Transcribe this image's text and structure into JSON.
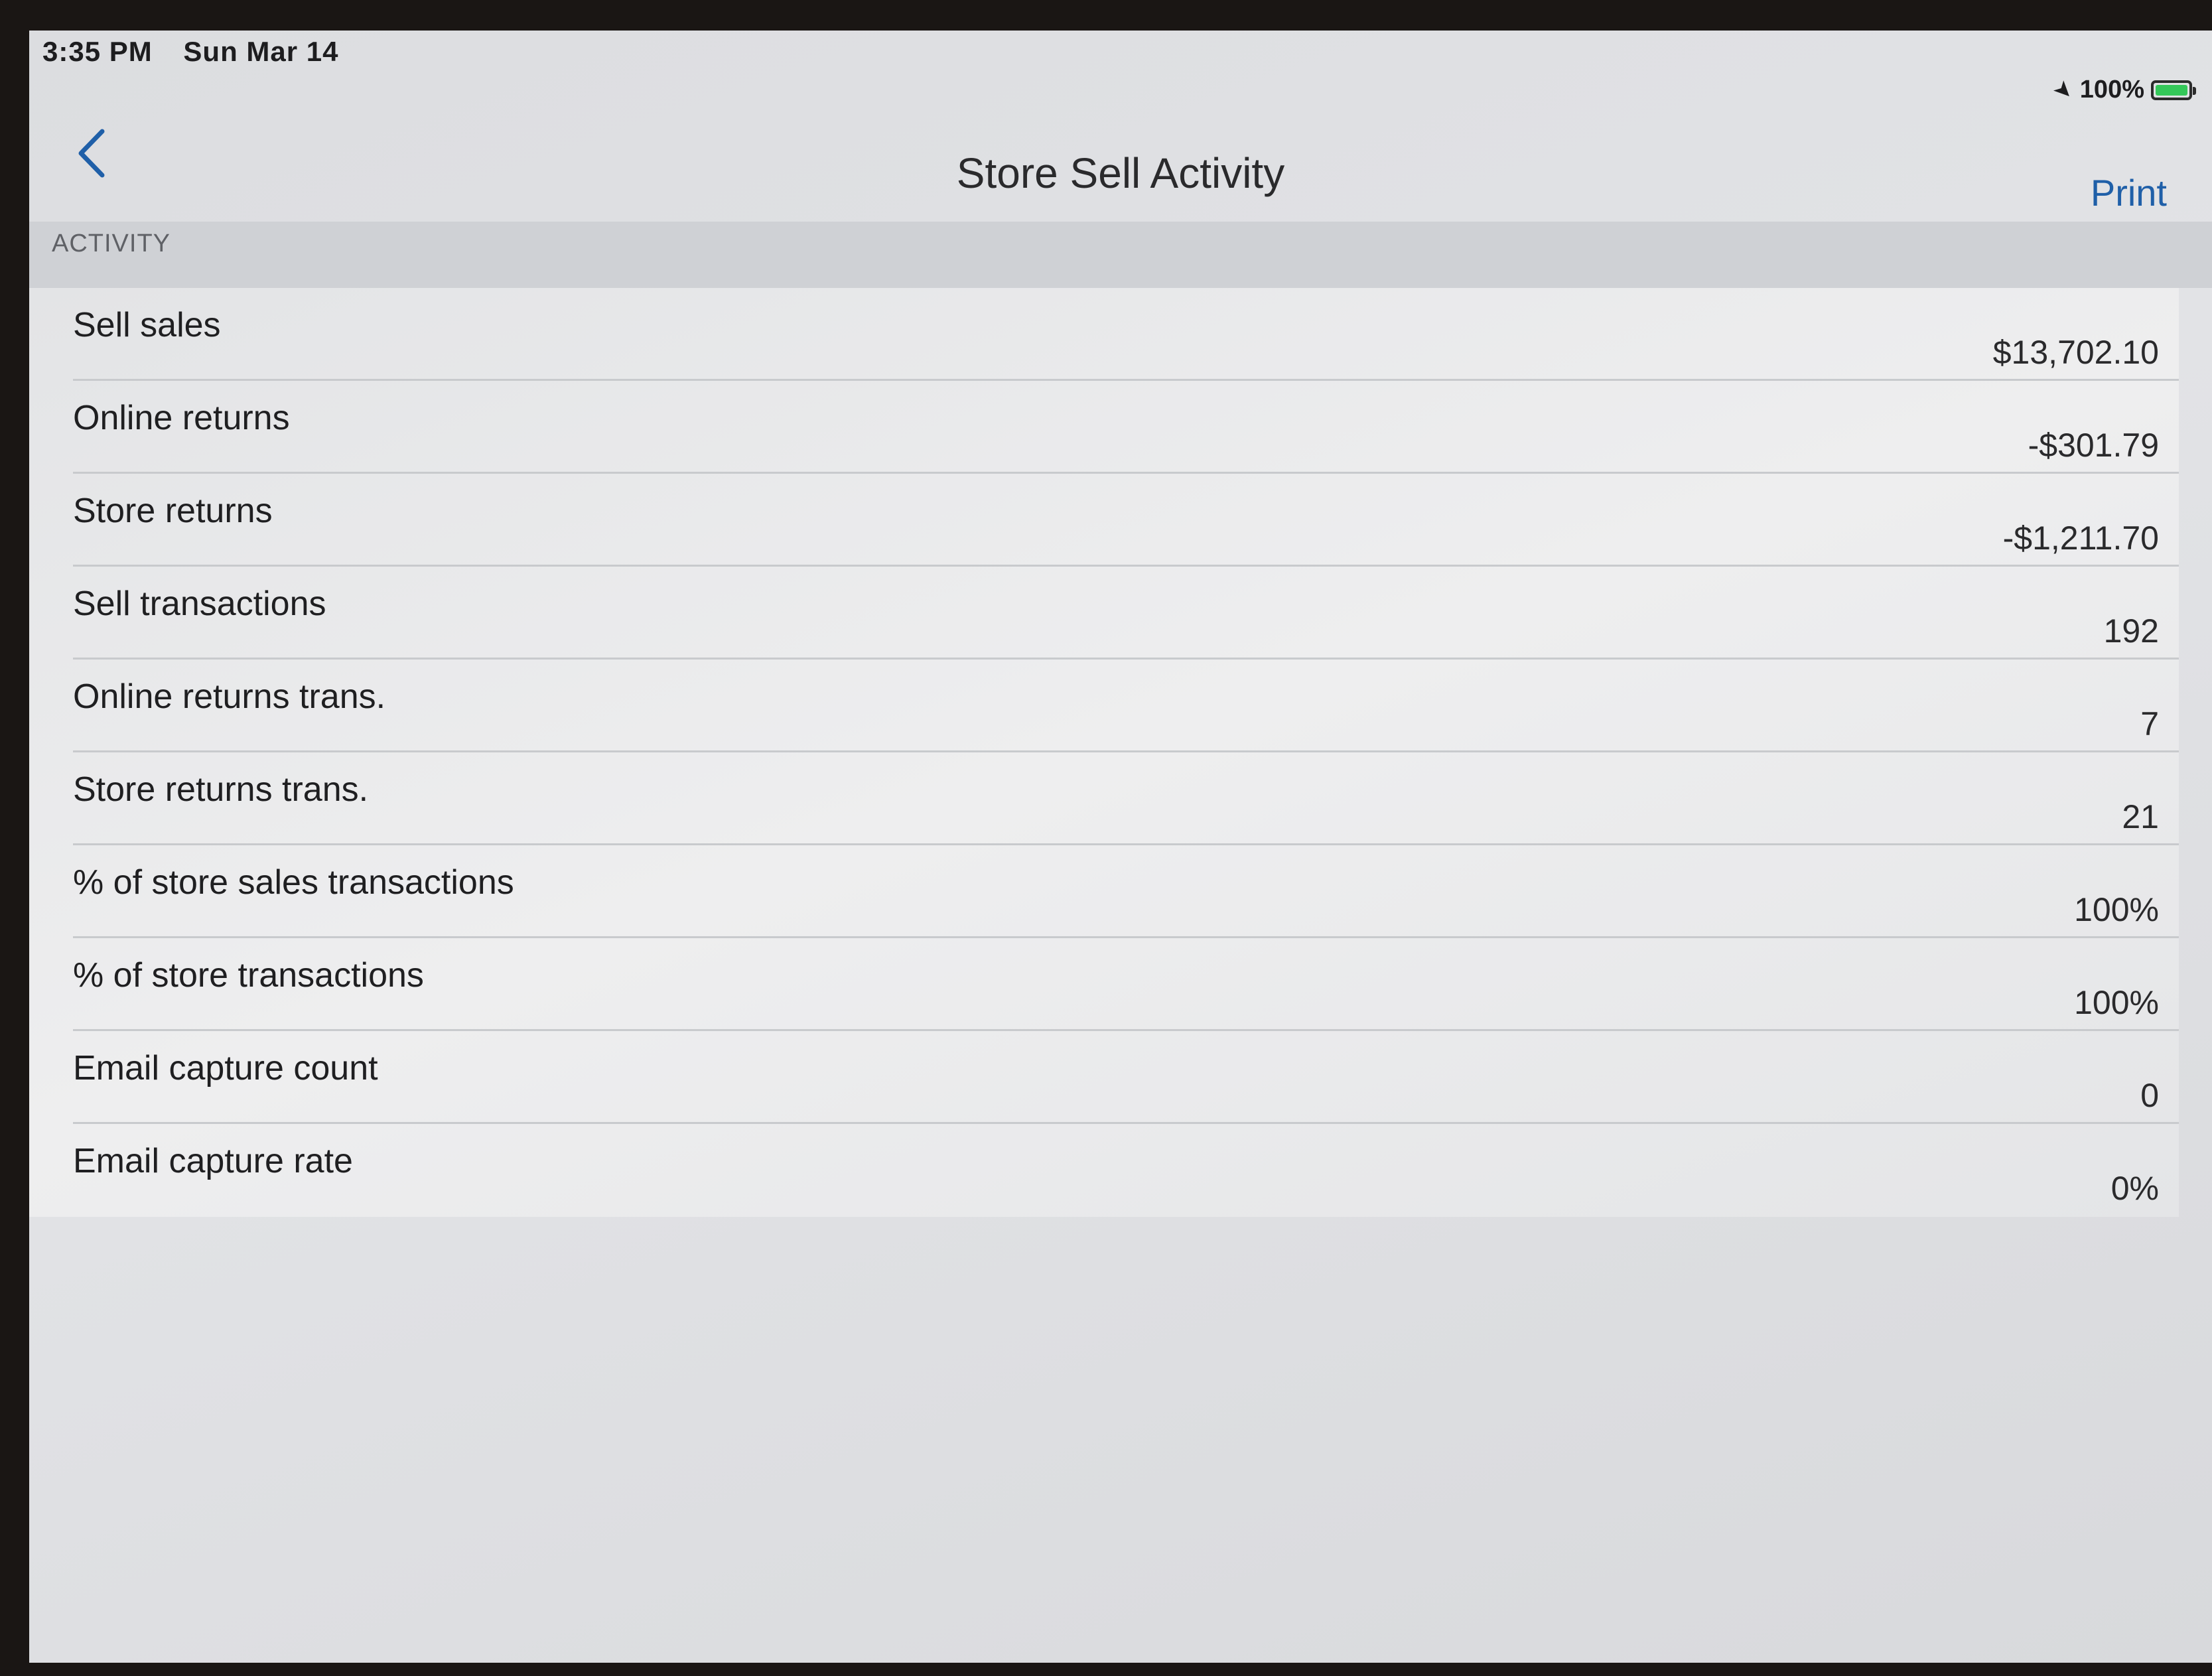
{
  "status_bar": {
    "time": "3:35 PM",
    "date": "Sun Mar 14",
    "battery": "100%",
    "location_icon": "location-arrow-icon",
    "battery_icon": "battery-charging-icon"
  },
  "nav": {
    "back_icon": "chevron-left-icon",
    "title": "Store Sell Activity",
    "print_label": "Print"
  },
  "section": {
    "header": "ACTIVITY"
  },
  "rows": [
    {
      "label": "Sell sales",
      "value": "$13,702.10"
    },
    {
      "label": "Online returns",
      "value": "-$301.79"
    },
    {
      "label": "Store returns",
      "value": "-$1,211.70"
    },
    {
      "label": "Sell transactions",
      "value": "192"
    },
    {
      "label": "Online returns trans.",
      "value": "7"
    },
    {
      "label": "Store returns trans.",
      "value": "21"
    },
    {
      "label": "% of store sales transactions",
      "value": "100%"
    },
    {
      "label": "% of store transactions",
      "value": "100%"
    },
    {
      "label": "Email capture count",
      "value": "0"
    },
    {
      "label": "Email capture rate",
      "value": "0%"
    }
  ],
  "colors": {
    "accent": "#1f5fa8",
    "battery_green": "#34c759"
  }
}
